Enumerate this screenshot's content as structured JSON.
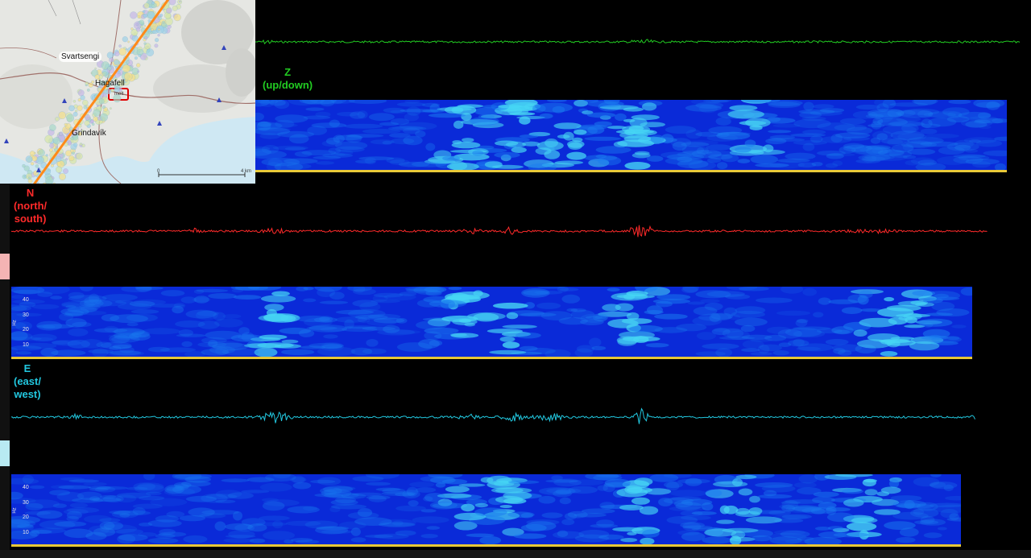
{
  "map": {
    "places": {
      "svartsengi": "Svartsengi",
      "hagafell": "Hagafell",
      "grindavik": "Grindavík",
      "station": "melt"
    },
    "scale": {
      "start": "0",
      "end": "4 km"
    },
    "colors": {
      "fissure_line": "#ff8a1a",
      "station_box": "#e00000",
      "water": "#cfe8f3",
      "land": "#e6e7e3"
    }
  },
  "channels": {
    "z": {
      "letter": "Z",
      "desc": "(up/down)",
      "color": "#22cc22"
    },
    "n": {
      "letter": "N",
      "desc1": "(north/",
      "desc2": "south)",
      "color": "#ff2a2a"
    },
    "e": {
      "letter": "E",
      "desc1": "(east/",
      "desc2": "west)",
      "color": "#22c8e0"
    }
  },
  "spectrogram": {
    "yaxis_ticks": [
      "40",
      "30",
      "20",
      "10"
    ],
    "yaxis_unit": "Hz",
    "colors": {
      "base": "#0a2ad8",
      "mid": "#1a7cf0",
      "high": "#46d6f4",
      "floor": "#e8c838"
    }
  }
}
